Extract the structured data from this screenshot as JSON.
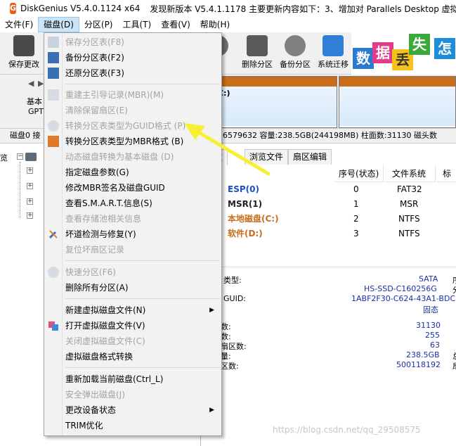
{
  "window": {
    "app_title": "DiskGenius V5.4.0.1124 x64",
    "news": "发现新版本 V5.4.1.1178 主要更新内容如下：3、增加对 Parallels Desktop 虚拟磁"
  },
  "menubar": [
    "文件(F)",
    "磁盘(D)",
    "分区(P)",
    "工具(T)",
    "查看(V)",
    "帮助(H)"
  ],
  "toolbar": [
    "保存更改",
    "化",
    "删除分区",
    "备份分区",
    "系统迁移"
  ],
  "banner": [
    "数",
    "据",
    "丢",
    "失",
    "怎"
  ],
  "diskbar": {
    "basic": "基本",
    "gpt": "GPT",
    "partition_label": "(C:)",
    "partition_suffix": "B"
  },
  "diskinfo": "磁盘0 接",
  "diskinfo_right": "16579632  容量:238.5GB(244198MB)  柱面数:31130  磁头数",
  "tabs": [
    "参数",
    "浏览文件",
    "扇区编辑"
  ],
  "table": {
    "headers": [
      "序号(状态)",
      "文件系统",
      "标识"
    ],
    "rows": [
      {
        "name": "ESP(0)",
        "num": "0",
        "fs": "FAT32"
      },
      {
        "name": "MSR(1)",
        "num": "1",
        "fs": "MSR"
      },
      {
        "name": "本地磁盘(C:)",
        "num": "2",
        "fs": "NTFS"
      },
      {
        "name": "软件(D:)",
        "num": "3",
        "fs": "NTFS"
      }
    ]
  },
  "details": {
    "type_label": "类型:",
    "type_value": "SATA",
    "type_suffix": "序",
    "model_value": "HS-SSD-C160256G",
    "model_suffix": "分",
    "guid_label": "GUID:",
    "guid_value": "1ABF2F30-C624-43A1-BDC",
    "state_value": "固态",
    "cyl_label": "数:",
    "cyl_value": "31130",
    "head_label": "数:",
    "head_value": "255",
    "sec_label": "扇区数:",
    "sec_value": "63",
    "cap_label": "量:",
    "cap_value": "238.5GB",
    "cap_suffix": "总",
    "total_label": "区数:",
    "total_value": "500118192",
    "total_suffix": "扇"
  },
  "dropdown": [
    {
      "label": "保存分区表(F8)",
      "disabled": true
    },
    {
      "label": "备份分区表(F2)",
      "disabled": false
    },
    {
      "label": "还原分区表(F3)",
      "disabled": false
    },
    {
      "label": "重建主引导记录(MBR)(M)",
      "disabled": true
    },
    {
      "label": "清除保留扇区(E)",
      "disabled": true
    },
    {
      "label": "转换分区表类型为GUID格式 (P)",
      "disabled": true
    },
    {
      "label": "转换分区表类型为MBR格式 (B)",
      "disabled": false
    },
    {
      "label": "动态磁盘转换为基本磁盘 (D)",
      "disabled": true
    },
    {
      "label": "指定磁盘参数(G)",
      "disabled": false
    },
    {
      "label": "修改MBR签名及磁盘GUID",
      "disabled": false
    },
    {
      "label": "查看S.M.A.R.T.信息(S)",
      "disabled": false
    },
    {
      "label": "查看存储池相关信息",
      "disabled": true
    },
    {
      "label": "坏道检测与修复(Y)",
      "disabled": false
    },
    {
      "label": "复位坏扇区记录",
      "disabled": true
    },
    {
      "label": "快速分区(F6)",
      "disabled": true
    },
    {
      "label": "删除所有分区(A)",
      "disabled": false
    },
    {
      "label": "新建虚拟磁盘文件(N)",
      "disabled": false,
      "submenu": true
    },
    {
      "label": "打开虚拟磁盘文件(V)",
      "disabled": false
    },
    {
      "label": "关闭虚拟磁盘文件(C)",
      "disabled": true
    },
    {
      "label": "虚拟磁盘格式转换",
      "disabled": false
    },
    {
      "label": "重新加载当前磁盘(Ctrl_L)",
      "disabled": false
    },
    {
      "label": "安全弹出磁盘(J)",
      "disabled": true
    },
    {
      "label": "更改设备状态",
      "disabled": false,
      "submenu": true
    },
    {
      "label": "TRIM优化",
      "disabled": false
    }
  ],
  "watermark": "https://blog.csdn.net/qq_29508575",
  "colors": {
    "accent_orange": "#c86d1a",
    "menu_highlight": "#cce4f7",
    "arrow_yellow": "#f7f032"
  }
}
